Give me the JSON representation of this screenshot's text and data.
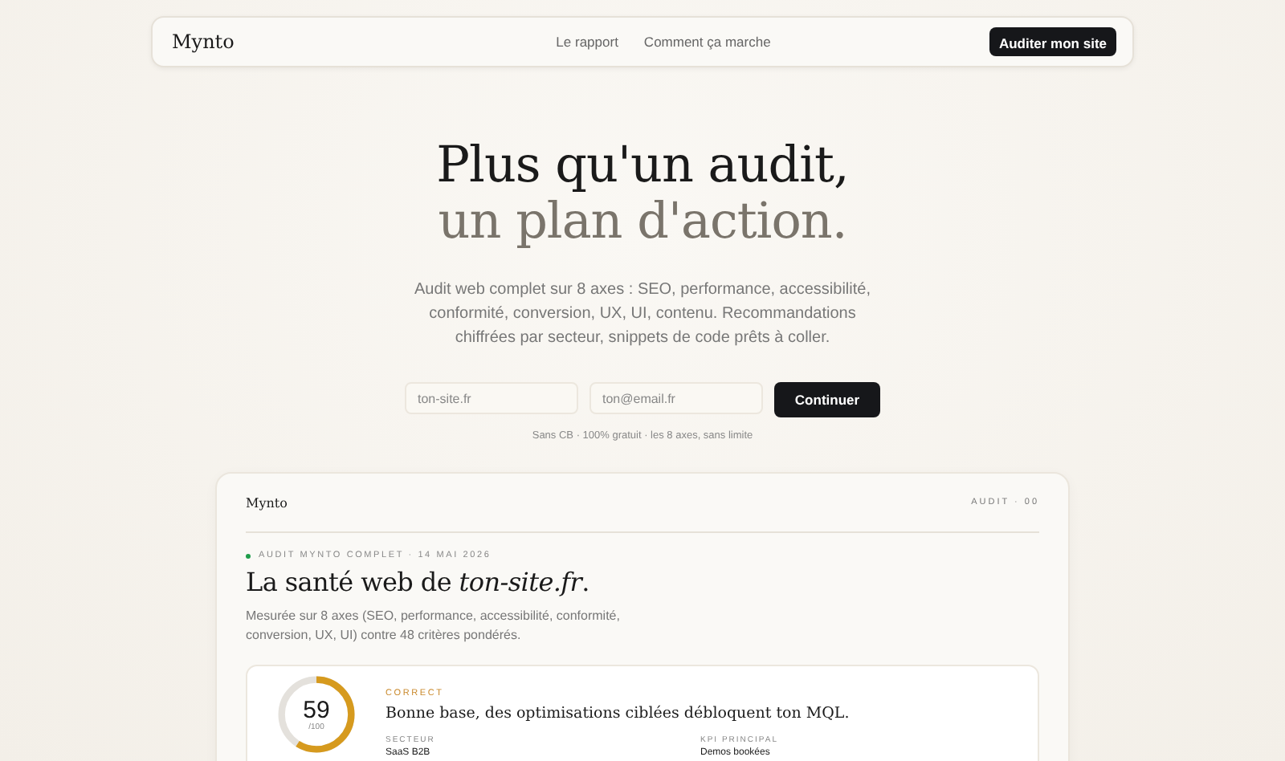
{
  "nav": {
    "logo": "Mynto",
    "links": [
      "Le rapport",
      "Comment ça marche"
    ],
    "cta": "Auditer mon site"
  },
  "hero": {
    "title_line1": "Plus qu'un audit,",
    "title_line2": "un plan d'action.",
    "description": "Audit web complet sur 8 axes : SEO, performance, accessibilité, conformité, conversion, UX, UI, contenu. Recommandations chiffrées par secteur, snippets de code prêts à coller.",
    "fields": [
      {
        "placeholder": "ton-site.fr"
      },
      {
        "placeholder": "ton@email.fr"
      }
    ],
    "submit": "Continuer",
    "note": "Sans CB · 100% gratuit · les 8 axes, sans limite"
  },
  "report": {
    "brand": "Mynto",
    "tag": "AUDIT · 00",
    "eyebrow": {
      "text": "AUDIT MYNTO COMPLET · 14 MAI 2026",
      "color": "#1f9d4a"
    },
    "title": "La santé web de *ton-site.fr*.",
    "description": "Mesurée sur 8 axes (SEO, performance, accessibilité, conformité, conversion, UX, UI) contre 48 critères pondérés.",
    "score": {
      "value": "59",
      "max": "/100",
      "level": 0.59,
      "grade": "CORRECT",
      "summary": "Bonne base, des optimisations ciblées débloquent ton MQL.",
      "facts": [
        {
          "label": "SECTEUR",
          "value": "SaaS B2B"
        },
        {
          "label": "KPI PRINCIPAL",
          "value": "Demos bookées"
        }
      ]
    }
  }
}
